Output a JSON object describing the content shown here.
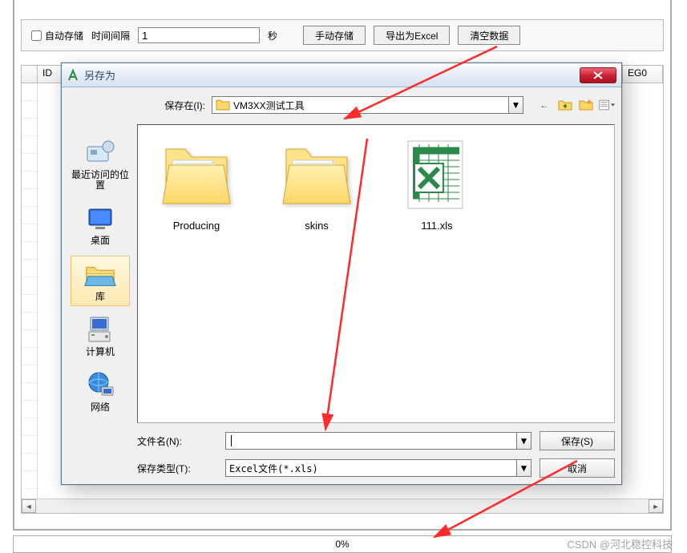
{
  "toolbar": {
    "auto_save_label": "自动存储",
    "interval_label": "时间间隔",
    "interval_value": "1",
    "interval_unit": "秒",
    "manual_save": "手动存储",
    "export_excel": "导出为Excel",
    "clear_data": "清空数据"
  },
  "grid": {
    "col_id": "ID",
    "col_right": "EG0"
  },
  "dialog": {
    "title": "另存为",
    "save_in_label": "保存在(I):",
    "location": "VM3XX测试工具",
    "sidebar": [
      {
        "key": "recent",
        "label": "最近访问的位置"
      },
      {
        "key": "desktop",
        "label": "桌面"
      },
      {
        "key": "library",
        "label": "库"
      },
      {
        "key": "computer",
        "label": "计算机"
      },
      {
        "key": "network",
        "label": "网络"
      }
    ],
    "files": [
      {
        "name": "Producing",
        "type": "folder"
      },
      {
        "name": "skins",
        "type": "folder"
      },
      {
        "name": "111.xls",
        "type": "excel"
      }
    ],
    "filename_label": "文件名(N):",
    "filename_value": "",
    "filetype_label": "保存类型(T):",
    "filetype_value": "Excel文件(*.xls)",
    "save_btn": "保存(S)",
    "cancel_btn": "取消"
  },
  "progress": {
    "text": "0%"
  },
  "watermark": "CSDN @河北稳控科技"
}
